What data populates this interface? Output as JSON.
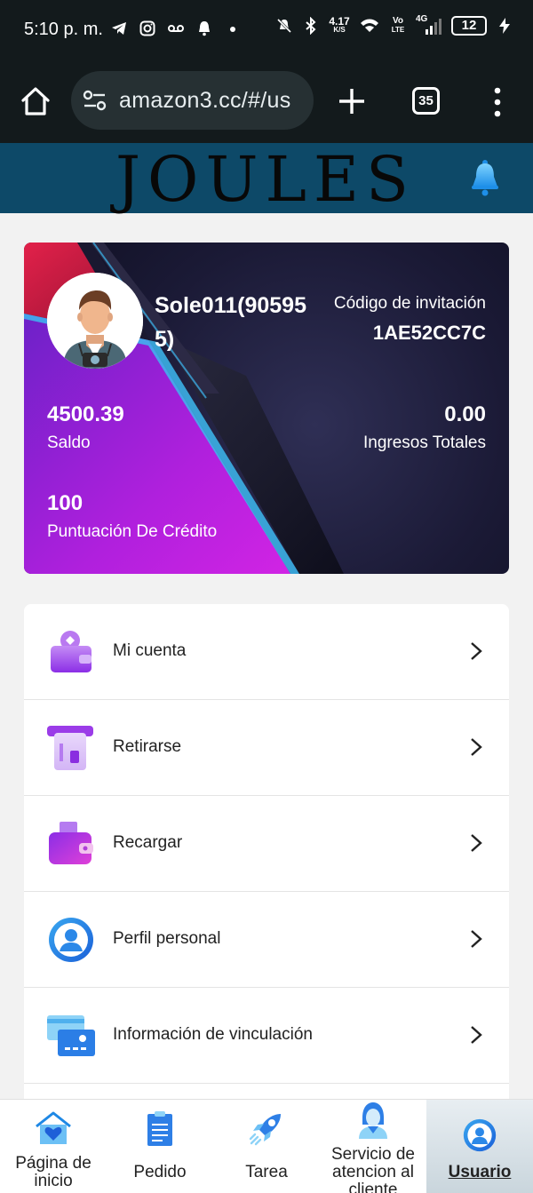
{
  "status_bar": {
    "time": "5:10 p. m.",
    "network_speed": "4.17",
    "network_speed_unit": "K/S",
    "volte_top": "Vo",
    "volte_bottom": "LTE",
    "network_type": "4G",
    "battery": "12",
    "left_icons": [
      "telegram-icon",
      "instagram-icon",
      "voicemail-icon",
      "bell-icon",
      "dot-icon"
    ],
    "right_icons": [
      "mute-icon",
      "bluetooth-icon",
      "wifi-icon",
      "signal-icon",
      "charging-icon"
    ]
  },
  "browser": {
    "url": "amazon3.cc/#/us",
    "tab_count": "35"
  },
  "header": {
    "brand": "JOULES"
  },
  "profile": {
    "username": "Sole011(905955)",
    "invite_label": "Código de invitación",
    "invite_code": "1AE52CC7C",
    "balance_value": "4500.39",
    "balance_label": "Saldo",
    "income_value": "0.00",
    "income_label": "Ingresos Totales",
    "credit_value": "100",
    "credit_label": "Puntuación De Crédito"
  },
  "menu": {
    "items": [
      {
        "label": "Mi cuenta",
        "icon": "wallet-icon"
      },
      {
        "label": "Retirarse",
        "icon": "atm-withdraw-icon"
      },
      {
        "label": "Recargar",
        "icon": "recharge-wallet-icon"
      },
      {
        "label": "Perfil personal",
        "icon": "user-profile-icon"
      },
      {
        "label": "Información de vinculación",
        "icon": "bank-card-icon"
      }
    ]
  },
  "nav": {
    "items": [
      {
        "label": "Página de inicio",
        "icon": "home-heart-icon"
      },
      {
        "label": "Pedido",
        "icon": "clipboard-icon"
      },
      {
        "label": "Tarea",
        "icon": "rocket-icon"
      },
      {
        "label": "Servicio de atencion al cliente",
        "icon": "support-agent-icon"
      },
      {
        "label": "Usuario",
        "icon": "user-icon",
        "active": true
      }
    ]
  },
  "colors": {
    "header_bg": "#0d4968",
    "card_bg": "#1b1a36",
    "card_accent_purple": "#b21fe0",
    "card_accent_red": "#d61c3a",
    "menu_icon_purple": "#9b3ce8",
    "nav_blue": "#1e88e5"
  }
}
